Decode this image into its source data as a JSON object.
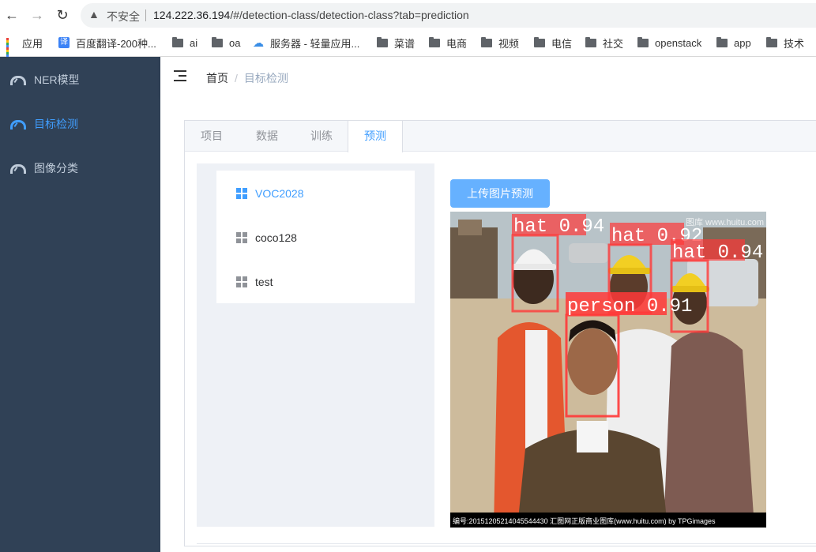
{
  "browser": {
    "insecure_label": "不安全",
    "url_host": "124.222.36.194",
    "url_path": "/#/detection-class/detection-class?tab=prediction"
  },
  "bookmarks": [
    {
      "label": "应用",
      "icon": "apps-icon"
    },
    {
      "label": "百度翻译-200种...",
      "icon": "translate-icon"
    },
    {
      "label": "ai",
      "icon": "folder-icon"
    },
    {
      "label": "oa",
      "icon": "folder-icon"
    },
    {
      "label": "服务器 - 轻量应用...",
      "icon": "cloud-icon"
    },
    {
      "label": "菜谱",
      "icon": "folder-icon"
    },
    {
      "label": "电商",
      "icon": "folder-icon"
    },
    {
      "label": "视频",
      "icon": "folder-icon"
    },
    {
      "label": "电信",
      "icon": "folder-icon"
    },
    {
      "label": "社交",
      "icon": "folder-icon"
    },
    {
      "label": "openstack",
      "icon": "folder-icon"
    },
    {
      "label": "app",
      "icon": "folder-icon"
    },
    {
      "label": "技术",
      "icon": "folder-icon"
    }
  ],
  "sidebar": {
    "items": [
      {
        "label": "NER模型",
        "icon": "dashboard-icon",
        "active": false
      },
      {
        "label": "目标检测",
        "icon": "dashboard-icon",
        "active": true
      },
      {
        "label": "图像分类",
        "icon": "dashboard-icon",
        "active": false
      }
    ]
  },
  "breadcrumb": {
    "home": "首页",
    "separator": "/",
    "current": "目标检测"
  },
  "tabs": [
    {
      "label": "项目",
      "active": false
    },
    {
      "label": "数据",
      "active": false
    },
    {
      "label": "训练",
      "active": false
    },
    {
      "label": "预测",
      "active": true
    }
  ],
  "datasets": [
    {
      "label": "VOC2028",
      "active": true
    },
    {
      "label": "coco128",
      "active": false
    },
    {
      "label": "test",
      "active": false
    }
  ],
  "upload_button": "上传图片预测",
  "prediction_image": {
    "watermark": "图库 www.huitu.com",
    "caption": "编号:20151205214045544430  汇图网正版商业图库(www.huitu.com) by TPGimages",
    "detections": [
      {
        "label": "hat 0.94"
      },
      {
        "label": "hat 0.92"
      },
      {
        "label": "hat 0.94"
      },
      {
        "label": "person 0.91"
      }
    ]
  },
  "colors": {
    "sidebar_bg": "#304156",
    "sidebar_text": "#bfcbd9",
    "accent": "#409eff",
    "button_bg": "#66b1ff",
    "detection_box": "#ff3838"
  }
}
